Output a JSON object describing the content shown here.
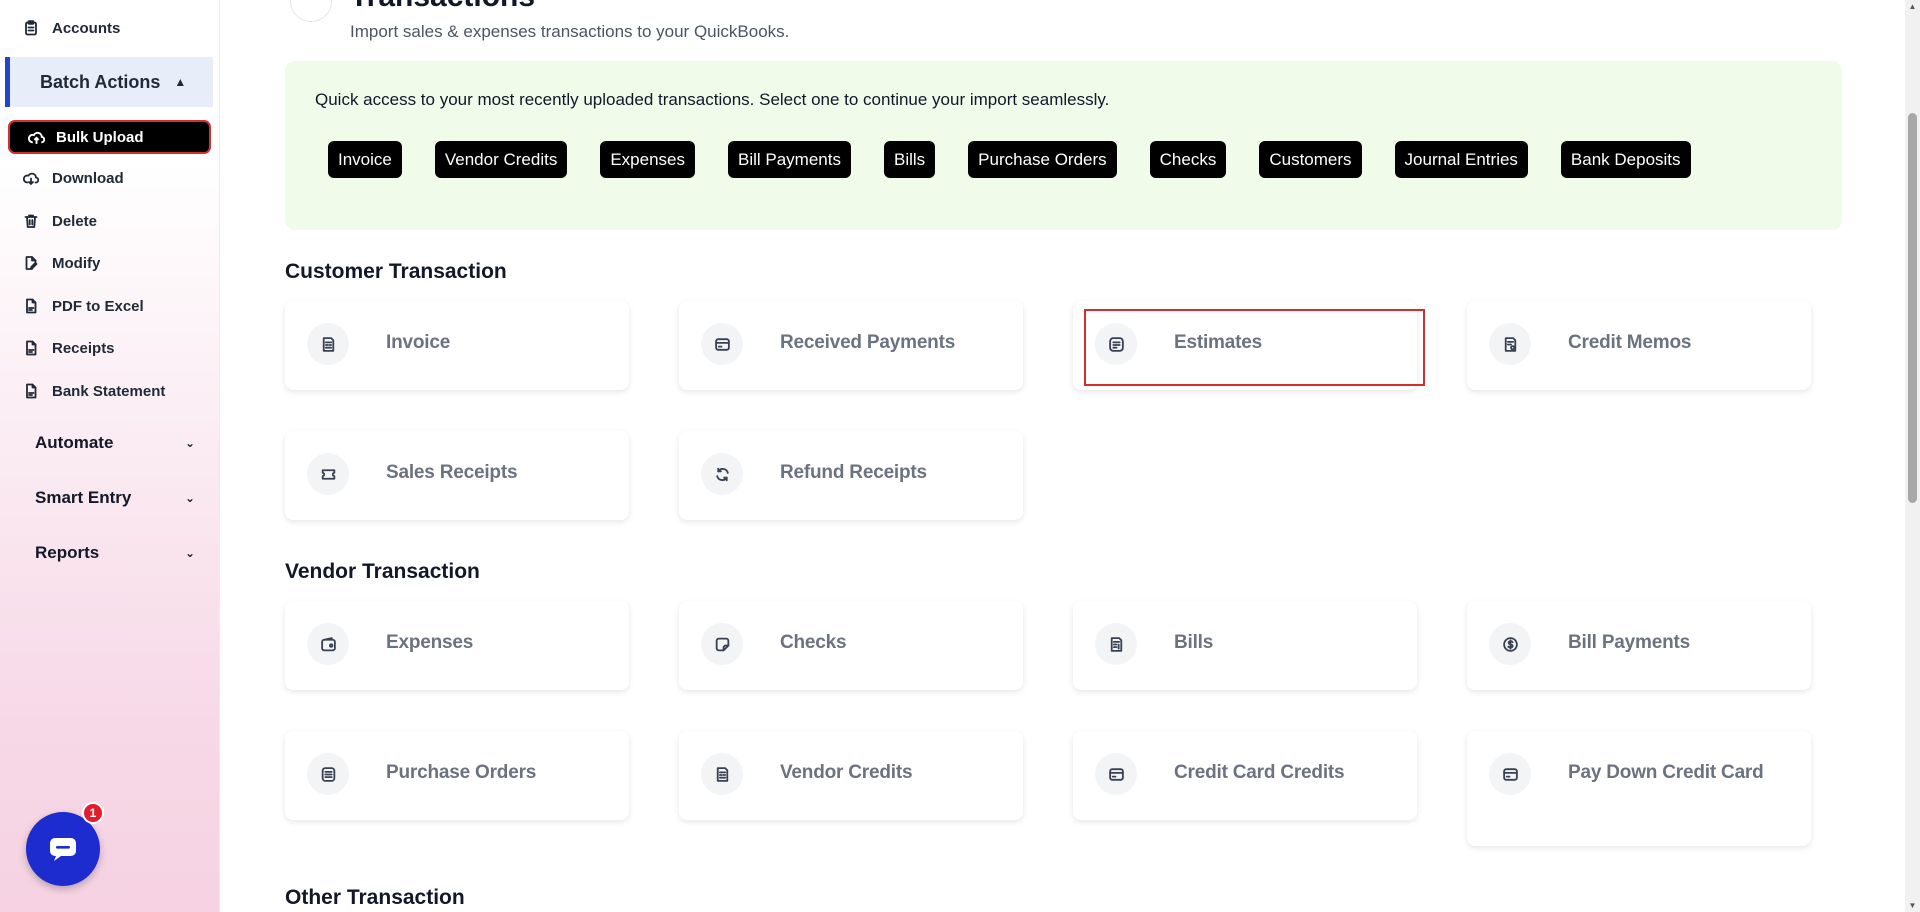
{
  "sidebar": {
    "top_items": [
      {
        "label": "Accounts",
        "icon": "clipboard-icon"
      }
    ],
    "batch_actions": {
      "label": "Batch Actions",
      "icon": "chevron-up-icon"
    },
    "batch_items": [
      {
        "label": "Bulk Upload",
        "icon": "cloud-upload-icon",
        "active": true
      },
      {
        "label": "Download",
        "icon": "cloud-download-icon"
      },
      {
        "label": "Delete",
        "icon": "trash-icon"
      },
      {
        "label": "Modify",
        "icon": "edit-file-icon"
      },
      {
        "label": "PDF to Excel",
        "icon": "file-icon"
      },
      {
        "label": "Receipts",
        "icon": "file-icon"
      },
      {
        "label": "Bank Statement",
        "icon": "file-icon"
      }
    ],
    "groups": [
      {
        "label": "Automate",
        "icon": "chevron-down-icon"
      },
      {
        "label": "Smart Entry",
        "icon": "chevron-down-icon"
      },
      {
        "label": "Reports",
        "icon": "chevron-down-icon"
      }
    ],
    "chat": {
      "badge": "1",
      "icon": "chat-icon"
    }
  },
  "header": {
    "title": "Transactions",
    "subtitle": "Import sales & expenses transactions to your QuickBooks."
  },
  "quick_access": {
    "text": "Quick access to your most recently uploaded transactions. Select one to continue your import seamlessly.",
    "chips": [
      "Invoice",
      "Vendor Credits",
      "Expenses",
      "Bill Payments",
      "Bills",
      "Purchase Orders",
      "Checks",
      "Customers",
      "Journal Entries",
      "Bank Deposits"
    ]
  },
  "sections": {
    "customer": {
      "title": "Customer Transaction",
      "cards": [
        {
          "label": "Invoice",
          "icon": "invoice-icon"
        },
        {
          "label": "Received Payments",
          "icon": "card-icon"
        },
        {
          "label": "Estimates",
          "icon": "document-lines-icon",
          "highlighted": true
        },
        {
          "label": "Credit Memos",
          "icon": "memo-icon"
        },
        {
          "label": "Sales Receipts",
          "icon": "ticket-icon"
        },
        {
          "label": "Refund Receipts",
          "icon": "refresh-icon"
        }
      ]
    },
    "vendor": {
      "title": "Vendor Transaction",
      "cards": [
        {
          "label": "Expenses",
          "icon": "wallet-icon"
        },
        {
          "label": "Checks",
          "icon": "check-square-icon"
        },
        {
          "label": "Bills",
          "icon": "bill-icon"
        },
        {
          "label": "Bill Payments",
          "icon": "dollar-circle-icon"
        },
        {
          "label": "Purchase Orders",
          "icon": "list-doc-icon"
        },
        {
          "label": "Vendor Credits",
          "icon": "invoice-icon"
        },
        {
          "label": "Credit Card Credits",
          "icon": "credit-card-icon"
        },
        {
          "label": "Pay Down Credit Card",
          "icon": "credit-card-icon"
        }
      ]
    },
    "other": {
      "title": "Other Transaction"
    }
  },
  "colors": {
    "accent": "#2445c9",
    "chat": "#1d2ccf",
    "highlight": "#d32f2f",
    "quick_panel_bg": "#f0fbea"
  }
}
